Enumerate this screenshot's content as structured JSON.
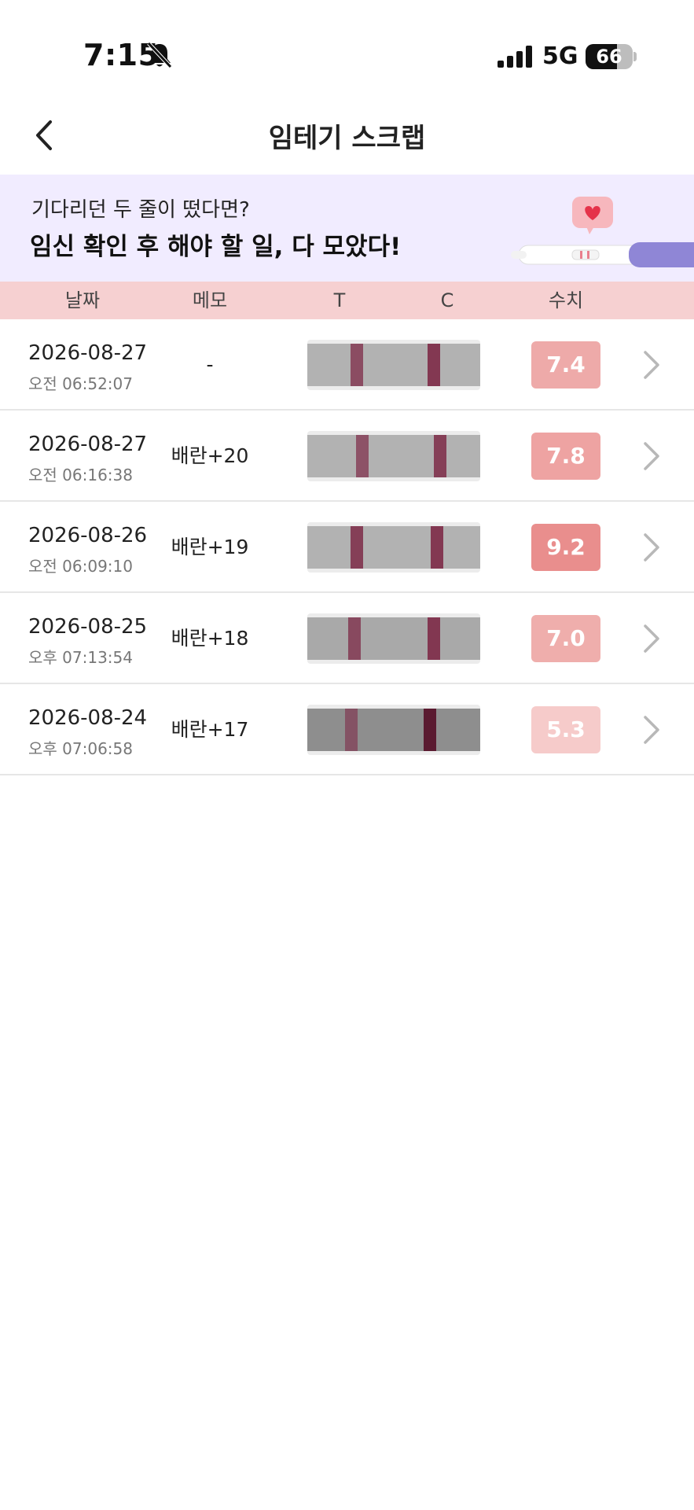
{
  "status_bar": {
    "time": "7:15",
    "network": "5G",
    "battery": "66",
    "battery_level": 0.66
  },
  "header": {
    "title": "임테기 스크랩"
  },
  "banner": {
    "subtitle": "기다리던 두 줄이 떴다면?",
    "headline": "임신 확인 후 해야 할 일, 다 모았다!"
  },
  "table": {
    "columns": {
      "date": "날짜",
      "memo": "메모",
      "t": "T",
      "c": "C",
      "value": "수치"
    },
    "rows": [
      {
        "date": "2026-08-27",
        "time": "오전 06:52:07",
        "memo": "-",
        "value": "7.4",
        "badge_color": "#eeaaa9"
      },
      {
        "date": "2026-08-27",
        "time": "오전 06:16:38",
        "memo": "배란+20",
        "value": "7.8",
        "badge_color": "#eea3a2"
      },
      {
        "date": "2026-08-26",
        "time": "오전 06:09:10",
        "memo": "배란+19",
        "value": "9.2",
        "badge_color": "#e98e8d"
      },
      {
        "date": "2026-08-25",
        "time": "오후 07:13:54",
        "memo": "배란+18",
        "value": "7.0",
        "badge_color": "#efaeac"
      },
      {
        "date": "2026-08-24",
        "time": "오후 07:06:58",
        "memo": "배란+17",
        "value": "5.3",
        "badge_color": "#f6cbca"
      }
    ]
  },
  "colors": {
    "accent_pink": "#f6d0d1",
    "banner_bg": "#f1ecff",
    "test_line": "#7d2a47"
  },
  "icons": [
    "bell-off-icon",
    "signal-icon",
    "battery-icon",
    "chevron-left-icon",
    "chevron-right-icon",
    "pregnancy-test-illustration"
  ]
}
